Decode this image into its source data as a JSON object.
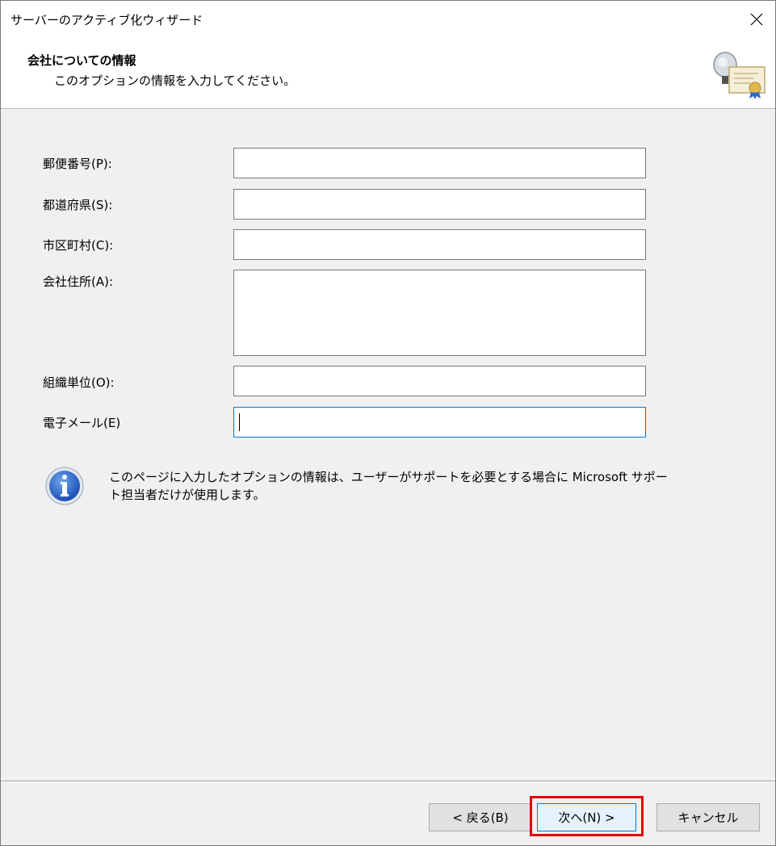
{
  "window": {
    "title": "サーバーのアクティブ化ウィザード"
  },
  "header": {
    "title": "会社についての情報",
    "subtitle": "このオプションの情報を入力してください。",
    "icon": "certificate-icon"
  },
  "form": {
    "fields": [
      {
        "label": "郵便番号(P):",
        "value": ""
      },
      {
        "label": "都道府県(S):",
        "value": ""
      },
      {
        "label": "市区町村(C):",
        "value": ""
      },
      {
        "label": "会社住所(A):",
        "value": ""
      },
      {
        "label": "組織単位(O):",
        "value": ""
      },
      {
        "label": "電子メール(E)",
        "value": ""
      }
    ]
  },
  "info": {
    "icon": "info-icon",
    "text": "このページに入力したオプションの情報は、ユーザーがサポートを必要とする場合に Microsoft サポート担当者だけが使用します。"
  },
  "buttons": {
    "back": "< 戻る(B)",
    "next": "次へ(N) >",
    "cancel": "キャンセル"
  }
}
